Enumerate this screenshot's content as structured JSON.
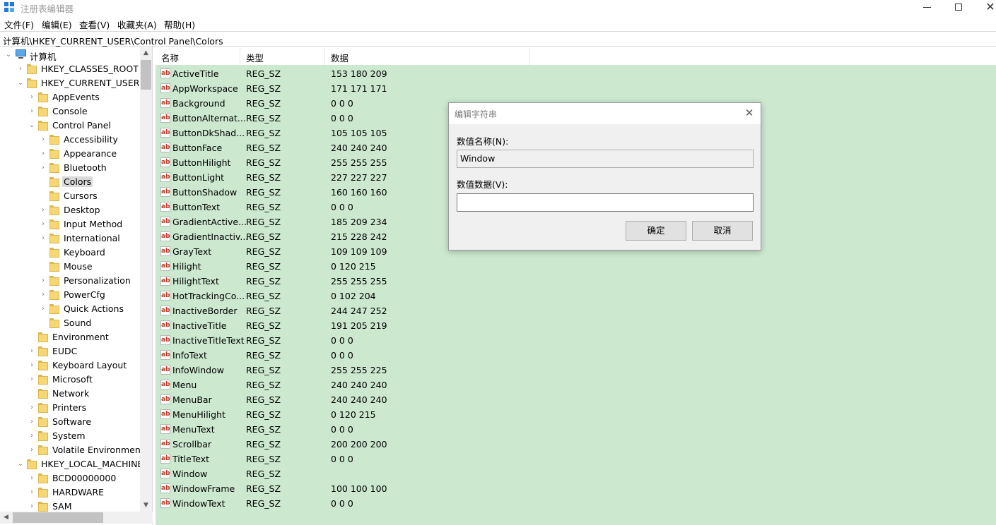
{
  "window": {
    "title": "注册表编辑器",
    "controls": [
      "minimize",
      "maximize",
      "close"
    ]
  },
  "menu": [
    "文件(F)",
    "编辑(E)",
    "查看(V)",
    "收藏夹(A)",
    "帮助(H)"
  ],
  "address": "计算机\\HKEY_CURRENT_USER\\Control Panel\\Colors",
  "tree": {
    "root": "计算机",
    "nodes": [
      {
        "label": "HKEY_CLASSES_ROOT",
        "level": 1,
        "expanded": false
      },
      {
        "label": "HKEY_CURRENT_USER",
        "level": 1,
        "expanded": true
      },
      {
        "label": "AppEvents",
        "level": 2,
        "expanded": false
      },
      {
        "label": "Console",
        "level": 2,
        "expanded": false
      },
      {
        "label": "Control Panel",
        "level": 2,
        "expanded": true
      },
      {
        "label": "Accessibility",
        "level": 3,
        "expanded": false
      },
      {
        "label": "Appearance",
        "level": 3,
        "expanded": false
      },
      {
        "label": "Bluetooth",
        "level": 3,
        "expanded": false
      },
      {
        "label": "Colors",
        "level": 3,
        "expanded": null,
        "selected": true
      },
      {
        "label": "Cursors",
        "level": 3,
        "expanded": null
      },
      {
        "label": "Desktop",
        "level": 3,
        "expanded": false
      },
      {
        "label": "Input Method",
        "level": 3,
        "expanded": false
      },
      {
        "label": "International",
        "level": 3,
        "expanded": false
      },
      {
        "label": "Keyboard",
        "level": 3,
        "expanded": null
      },
      {
        "label": "Mouse",
        "level": 3,
        "expanded": null
      },
      {
        "label": "Personalization",
        "level": 3,
        "expanded": false
      },
      {
        "label": "PowerCfg",
        "level": 3,
        "expanded": false
      },
      {
        "label": "Quick Actions",
        "level": 3,
        "expanded": false
      },
      {
        "label": "Sound",
        "level": 3,
        "expanded": null
      },
      {
        "label": "Environment",
        "level": 2,
        "expanded": null
      },
      {
        "label": "EUDC",
        "level": 2,
        "expanded": false
      },
      {
        "label": "Keyboard Layout",
        "level": 2,
        "expanded": false
      },
      {
        "label": "Microsoft",
        "level": 2,
        "expanded": false
      },
      {
        "label": "Network",
        "level": 2,
        "expanded": null
      },
      {
        "label": "Printers",
        "level": 2,
        "expanded": false
      },
      {
        "label": "Software",
        "level": 2,
        "expanded": false
      },
      {
        "label": "System",
        "level": 2,
        "expanded": false
      },
      {
        "label": "Volatile Environment",
        "level": 2,
        "expanded": false
      },
      {
        "label": "HKEY_LOCAL_MACHINE",
        "level": 1,
        "expanded": true
      },
      {
        "label": "BCD00000000",
        "level": 2,
        "expanded": false
      },
      {
        "label": "HARDWARE",
        "level": 2,
        "expanded": false
      },
      {
        "label": "SAM",
        "level": 2,
        "expanded": false
      }
    ]
  },
  "list": {
    "columns": [
      "名称",
      "类型",
      "数据"
    ],
    "rows": [
      {
        "name": "ActiveTitle",
        "type": "REG_SZ",
        "data": "153 180 209"
      },
      {
        "name": "AppWorkspace",
        "type": "REG_SZ",
        "data": "171 171 171"
      },
      {
        "name": "Background",
        "type": "REG_SZ",
        "data": "0 0 0"
      },
      {
        "name": "ButtonAlternat...",
        "type": "REG_SZ",
        "data": "0 0 0"
      },
      {
        "name": "ButtonDkShad...",
        "type": "REG_SZ",
        "data": "105 105 105"
      },
      {
        "name": "ButtonFace",
        "type": "REG_SZ",
        "data": "240 240 240"
      },
      {
        "name": "ButtonHilight",
        "type": "REG_SZ",
        "data": "255 255 255"
      },
      {
        "name": "ButtonLight",
        "type": "REG_SZ",
        "data": "227 227 227"
      },
      {
        "name": "ButtonShadow",
        "type": "REG_SZ",
        "data": "160 160 160"
      },
      {
        "name": "ButtonText",
        "type": "REG_SZ",
        "data": "0 0 0"
      },
      {
        "name": "GradientActive...",
        "type": "REG_SZ",
        "data": "185 209 234"
      },
      {
        "name": "GradientInactiv...",
        "type": "REG_SZ",
        "data": "215 228 242"
      },
      {
        "name": "GrayText",
        "type": "REG_SZ",
        "data": "109 109 109"
      },
      {
        "name": "Hilight",
        "type": "REG_SZ",
        "data": "0 120 215"
      },
      {
        "name": "HilightText",
        "type": "REG_SZ",
        "data": "255 255 255"
      },
      {
        "name": "HotTrackingCo...",
        "type": "REG_SZ",
        "data": "0 102 204"
      },
      {
        "name": "InactiveBorder",
        "type": "REG_SZ",
        "data": "244 247 252"
      },
      {
        "name": "InactiveTitle",
        "type": "REG_SZ",
        "data": "191 205 219"
      },
      {
        "name": "InactiveTitleText",
        "type": "REG_SZ",
        "data": "0 0 0"
      },
      {
        "name": "InfoText",
        "type": "REG_SZ",
        "data": "0 0 0"
      },
      {
        "name": "InfoWindow",
        "type": "REG_SZ",
        "data": "255 255 225"
      },
      {
        "name": "Menu",
        "type": "REG_SZ",
        "data": "240 240 240"
      },
      {
        "name": "MenuBar",
        "type": "REG_SZ",
        "data": "240 240 240"
      },
      {
        "name": "MenuHilight",
        "type": "REG_SZ",
        "data": "0 120 215"
      },
      {
        "name": "MenuText",
        "type": "REG_SZ",
        "data": "0 0 0"
      },
      {
        "name": "Scrollbar",
        "type": "REG_SZ",
        "data": "200 200 200"
      },
      {
        "name": "TitleText",
        "type": "REG_SZ",
        "data": "0 0 0"
      },
      {
        "name": "Window",
        "type": "REG_SZ",
        "data": ""
      },
      {
        "name": "WindowFrame",
        "type": "REG_SZ",
        "data": "100 100 100"
      },
      {
        "name": "WindowText",
        "type": "REG_SZ",
        "data": "0 0 0"
      }
    ]
  },
  "dialog": {
    "title": "编辑字符串",
    "name_label": "数值名称(N):",
    "name_value": "Window",
    "data_label": "数值数据(V):",
    "data_value": "",
    "ok_label": "确定",
    "cancel_label": "取消"
  },
  "colors": {
    "list_background": "#cce8cf",
    "selection": "#d9d9d9",
    "folder": "#f7d674"
  }
}
